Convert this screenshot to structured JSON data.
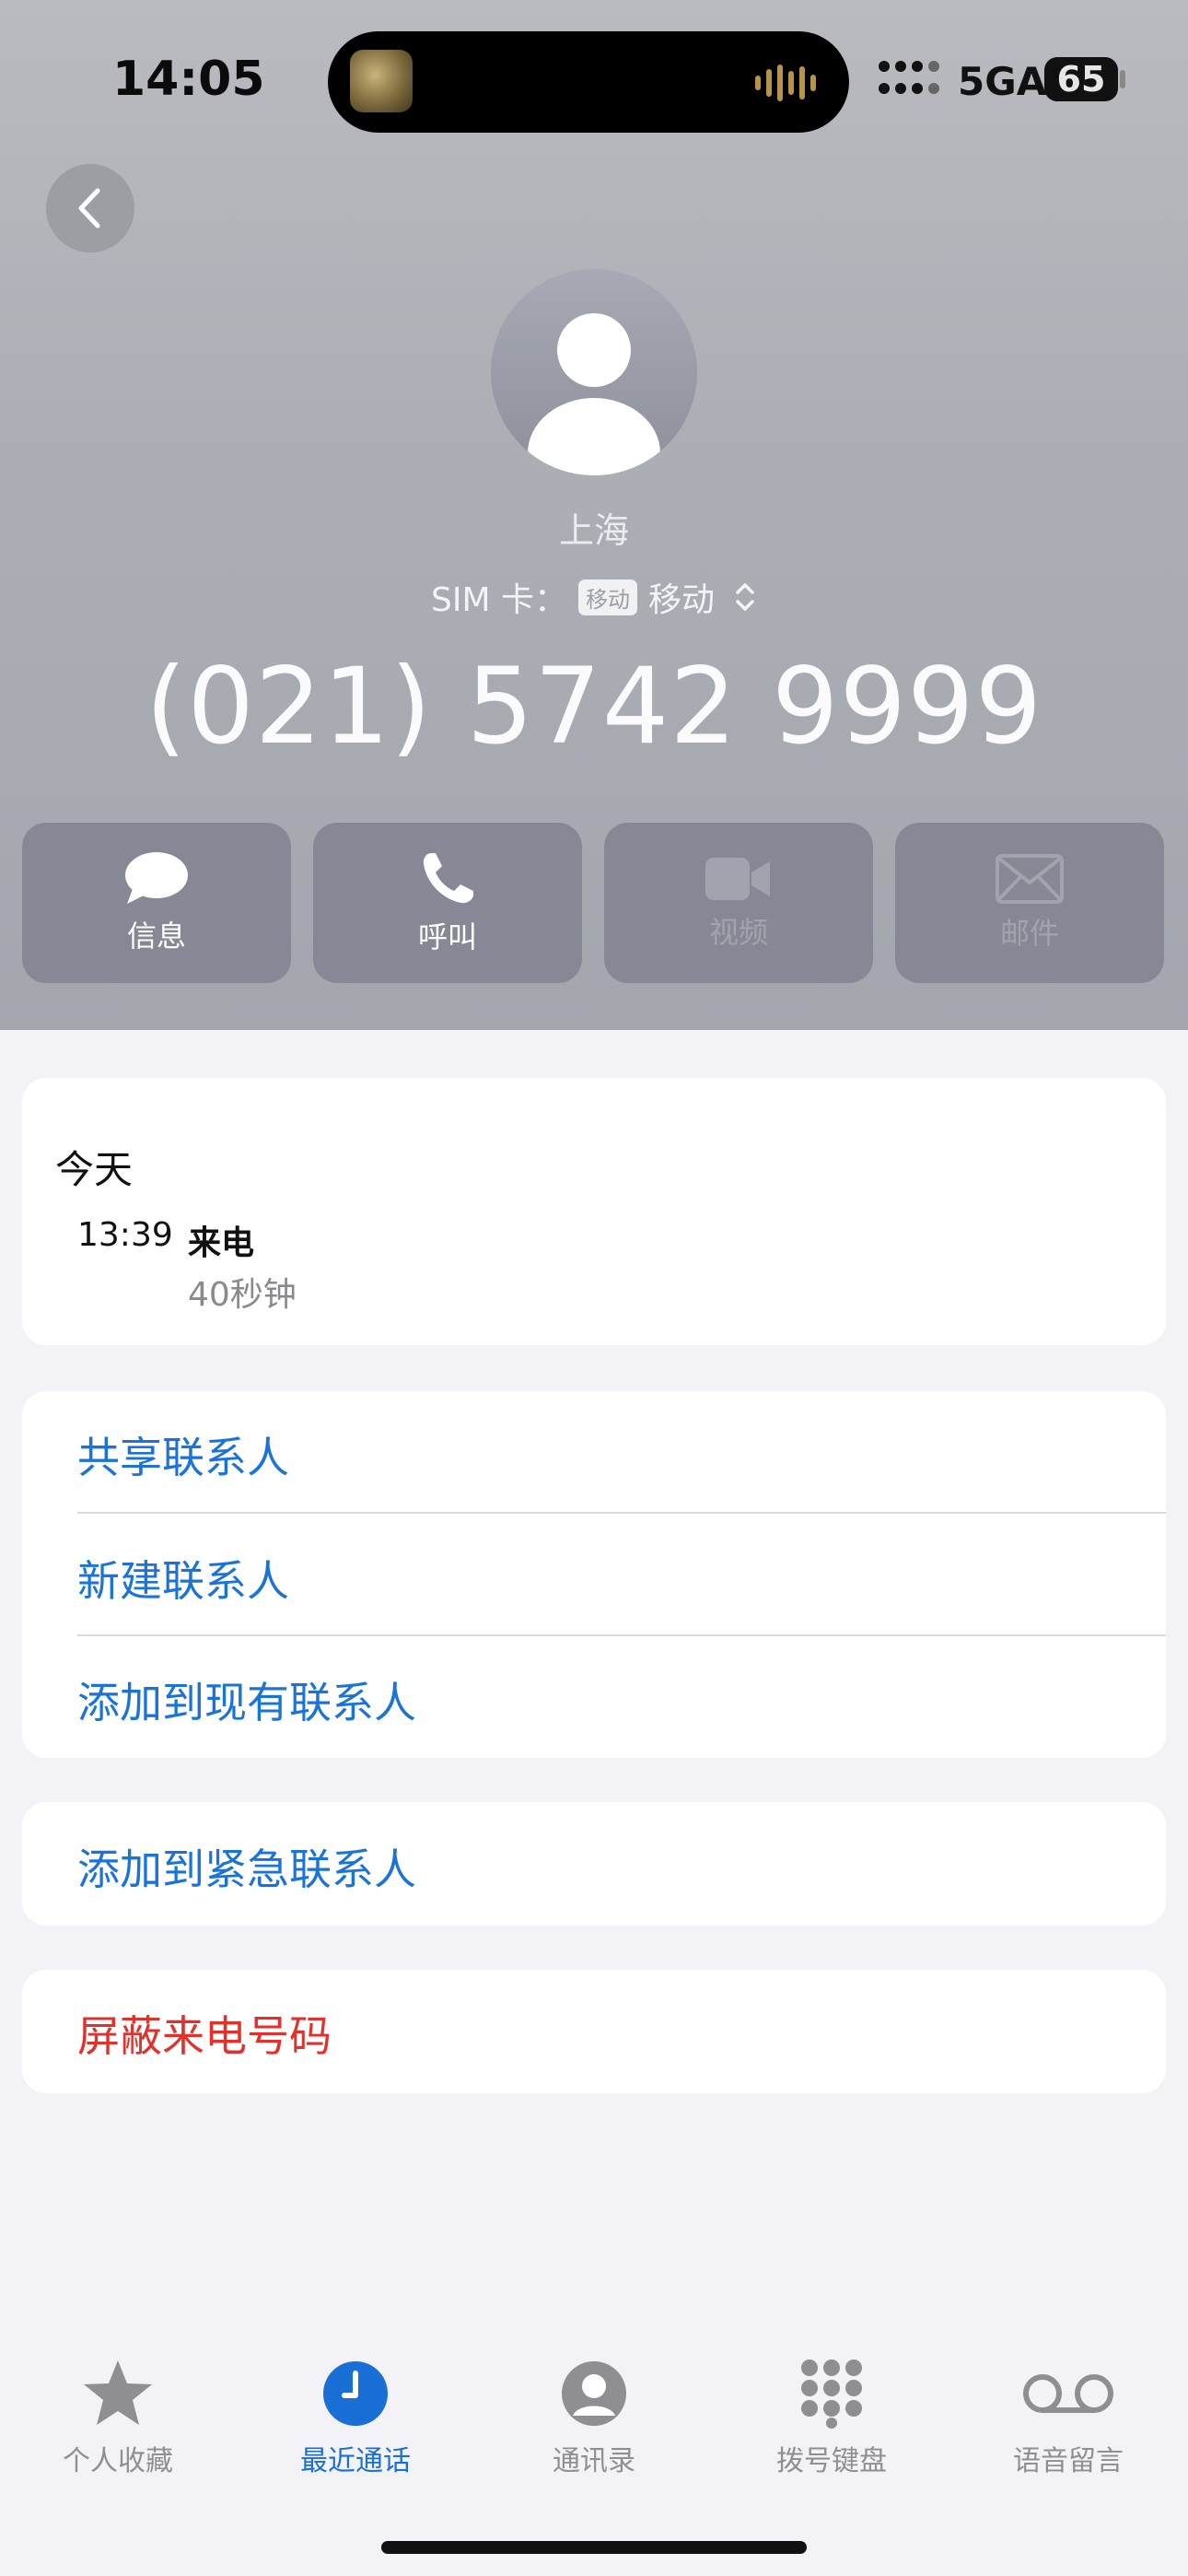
{
  "status_bar": {
    "time": "14:05",
    "network": "5GA",
    "battery": "65"
  },
  "contact": {
    "location": "上海",
    "sim_label": "SIM 卡：",
    "sim_badge": "移动",
    "sim_carrier": "移动",
    "phone_number": "(021) 5742 9999"
  },
  "actions": [
    {
      "label": "信息",
      "icon": "message-icon",
      "enabled": true
    },
    {
      "label": "呼叫",
      "icon": "phone-icon",
      "enabled": true
    },
    {
      "label": "视频",
      "icon": "video-icon",
      "enabled": false
    },
    {
      "label": "邮件",
      "icon": "mail-icon",
      "enabled": false
    }
  ],
  "history": {
    "day": "今天",
    "entries": [
      {
        "time": "13:39",
        "type": "来电",
        "duration": "40秒钟"
      }
    ]
  },
  "options": [
    "共享联系人",
    "新建联系人",
    "添加到现有联系人"
  ],
  "emergency": "添加到紧急联系人",
  "block": "屏蔽来电号码",
  "tabs": [
    {
      "label": "个人收藏",
      "icon": "star-icon",
      "active": false
    },
    {
      "label": "最近通话",
      "icon": "clock-icon",
      "active": true
    },
    {
      "label": "通讯录",
      "icon": "person-circle-icon",
      "active": false
    },
    {
      "label": "拨号键盘",
      "icon": "keypad-icon",
      "active": false
    },
    {
      "label": "语音留言",
      "icon": "voicemail-icon",
      "active": false
    }
  ],
  "colors": {
    "link": "#1a73d9",
    "danger": "#e0322b",
    "tab_active": "#1a6fd6",
    "tab_inactive": "#8e8e93"
  }
}
